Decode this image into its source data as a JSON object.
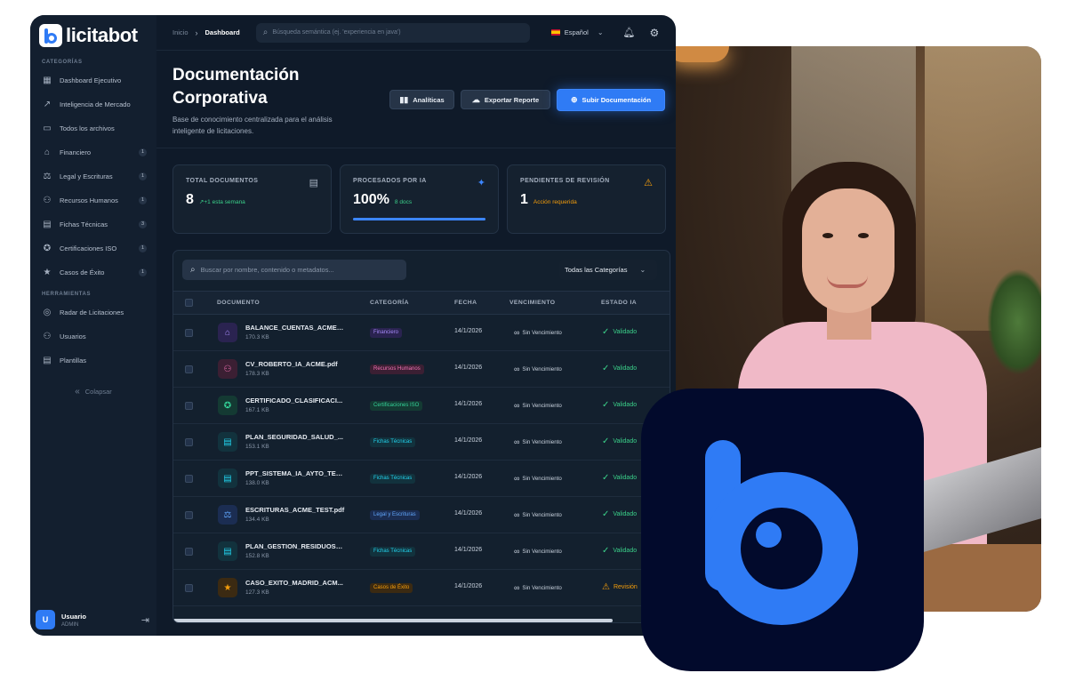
{
  "app": {
    "logo_text": "licitabot",
    "brand_color": "#2f7bf5"
  },
  "sidebar": {
    "section_categories": "CATEGORÍAS",
    "items": [
      {
        "label": "Dashboard Ejecutivo",
        "icon": "grid-icon",
        "count": ""
      },
      {
        "label": "Inteligencia de Mercado",
        "icon": "trend-icon",
        "count": ""
      },
      {
        "label": "Todos los archivos",
        "icon": "folder-icon",
        "count": ""
      },
      {
        "label": "Financiero",
        "icon": "bank-icon",
        "count": "1"
      },
      {
        "label": "Legal y Escrituras",
        "icon": "gavel-icon",
        "count": "1"
      },
      {
        "label": "Recursos Humanos",
        "icon": "users-icon",
        "count": "1"
      },
      {
        "label": "Fichas Técnicas",
        "icon": "file-icon",
        "count": "3"
      },
      {
        "label": "Certificaciones ISO",
        "icon": "badge-icon",
        "count": "1"
      },
      {
        "label": "Casos de Éxito",
        "icon": "star-icon",
        "count": "1"
      }
    ],
    "section_tools": "HERRAMIENTAS",
    "tools": [
      {
        "label": "Radar de Licitaciones",
        "icon": "radar-icon"
      },
      {
        "label": "Usuarios",
        "icon": "users-icon"
      },
      {
        "label": "Plantillas",
        "icon": "file-icon"
      }
    ],
    "collapse_label": "Colapsar",
    "user": {
      "initial": "U",
      "name": "Usuario",
      "role": "ADMIN"
    }
  },
  "topbar": {
    "breadcrumb_home": "Inicio",
    "breadcrumb_current": "Dashboard",
    "search_placeholder": "Búsqueda semántica (ej. 'experiencia en java')",
    "language": "Español"
  },
  "header": {
    "title": "Documentación Corporativa",
    "subtitle": "Base de conocimiento centralizada para el análisis inteligente de licitaciones.",
    "btn_analytics": "Analíticas",
    "btn_export": "Exportar Reporte",
    "btn_upload": "Subir Documentación"
  },
  "stats": [
    {
      "label": "TOTAL DOCUMENTOS",
      "value": "8",
      "note": "+1 esta semana",
      "note_color": "#3bd18a",
      "icon": "document-icon",
      "icon_color": "#a4afbf"
    },
    {
      "label": "PROCESADOS POR IA",
      "value": "100%",
      "note": "8 docs",
      "note_color": "#3bd18a",
      "icon": "sparkle-icon",
      "icon_color": "#3c86ff",
      "progress": 1.0
    },
    {
      "label": "PENDIENTES DE REVISIÓN",
      "value": "1",
      "note": "Acción requerida",
      "note_color": "#f59e0b",
      "icon": "warning-icon",
      "icon_color": "#f59e0b"
    }
  ],
  "table": {
    "search_placeholder": "Buscar por nombre, contenido o metadatos...",
    "filter_value": "Todas las Categorías",
    "columns": [
      "DOCUMENTO",
      "CATEGORÍA",
      "FECHA",
      "VENCIMIENTO",
      "ESTADO IA"
    ],
    "rows": [
      {
        "name": "BALANCE_CUENTAS_ACME_...",
        "size": "170.3 KB",
        "category": "Financiero",
        "cat_color": "#a78bfa",
        "cat_bg": "#2a2350",
        "icon": "bank-icon",
        "icon_bg": "#2a2350",
        "date": "14/1/2026",
        "expiry": "Sin Vencimiento",
        "state": "Validado",
        "state_color": "#3bd18a",
        "state_icon": "check-circle-icon"
      },
      {
        "name": "CV_ROBERTO_IA_ACME.pdf",
        "size": "178.3 KB",
        "category": "Recursos Humanos",
        "cat_color": "#f472b6",
        "cat_bg": "#3b1f33",
        "icon": "users-icon",
        "icon_bg": "#3b1f33",
        "date": "14/1/2026",
        "expiry": "Sin Vencimiento",
        "state": "Validado",
        "state_color": "#3bd18a",
        "state_icon": "check-circle-icon"
      },
      {
        "name": "CERTIFICADO_CLASIFICACI...",
        "size": "167.1 KB",
        "category": "Certificaciones ISO",
        "cat_color": "#34d399",
        "cat_bg": "#143a33",
        "icon": "badge-icon",
        "icon_bg": "#143a33",
        "date": "14/1/2026",
        "expiry": "Sin Vencimiento",
        "state": "Validado",
        "state_color": "#3bd18a",
        "state_icon": "check-circle-icon"
      },
      {
        "name": "PLAN_SEGURIDAD_SALUD_...",
        "size": "153.1 KB",
        "category": "Fichas Técnicas",
        "cat_color": "#22d3ee",
        "cat_bg": "#12323d",
        "icon": "file-icon",
        "icon_bg": "#12323d",
        "date": "14/1/2026",
        "expiry": "Sin Vencimiento",
        "state": "Validado",
        "state_color": "#3bd18a",
        "state_icon": "check-circle-icon"
      },
      {
        "name": "PPT_SISTEMA_IA_AYTO_TES...",
        "size": "138.0 KB",
        "category": "Fichas Técnicas",
        "cat_color": "#22d3ee",
        "cat_bg": "#12323d",
        "icon": "file-icon",
        "icon_bg": "#12323d",
        "date": "14/1/2026",
        "expiry": "Sin Vencimiento",
        "state": "Validado",
        "state_color": "#3bd18a",
        "state_icon": "check-circle-icon"
      },
      {
        "name": "ESCRITURAS_ACME_TEST.pdf",
        "size": "134.4 KB",
        "category": "Legal y Escrituras",
        "cat_color": "#60a5fa",
        "cat_bg": "#1b2d52",
        "icon": "gavel-icon",
        "icon_bg": "#1b2d52",
        "date": "14/1/2026",
        "expiry": "Sin Vencimiento",
        "state": "Validado",
        "state_color": "#3bd18a",
        "state_icon": "check-circle-icon"
      },
      {
        "name": "PLAN_GESTION_RESIDUOS_...",
        "size": "152.8 KB",
        "category": "Fichas Técnicas",
        "cat_color": "#22d3ee",
        "cat_bg": "#12323d",
        "icon": "file-icon",
        "icon_bg": "#12323d",
        "date": "14/1/2026",
        "expiry": "Sin Vencimiento",
        "state": "Validado",
        "state_color": "#3bd18a",
        "state_icon": "check-circle-icon"
      },
      {
        "name": "CASO_EXITO_MADRID_ACM...",
        "size": "127.3 KB",
        "category": "Casos de Éxito",
        "cat_color": "#f59e0b",
        "cat_bg": "#3b2a12",
        "icon": "star-icon",
        "icon_bg": "#3b2a12",
        "date": "14/1/2026",
        "expiry": "Sin Vencimiento",
        "state": "Revisión",
        "state_color": "#f59e0b",
        "state_icon": "warning-icon"
      }
    ]
  }
}
